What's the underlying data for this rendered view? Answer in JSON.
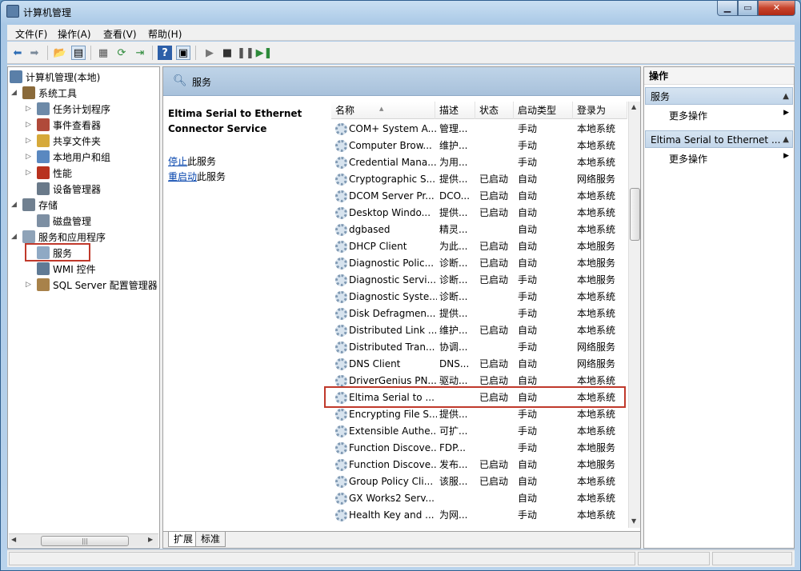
{
  "window": {
    "title": "计算机管理"
  },
  "menu": [
    "文件(F)",
    "操作(A)",
    "查看(V)",
    "帮助(H)"
  ],
  "tree": [
    {
      "label": "计算机管理(本地)",
      "icon": "computer-icon",
      "level": 0,
      "toggle": ""
    },
    {
      "label": "系统工具",
      "icon": "tools-icon",
      "level": 1,
      "toggle": "▲"
    },
    {
      "label": "任务计划程序",
      "icon": "clock-icon",
      "level": 2,
      "toggle": "▷"
    },
    {
      "label": "事件查看器",
      "icon": "event-viewer-icon",
      "level": 2,
      "toggle": "▷"
    },
    {
      "label": "共享文件夹",
      "icon": "shared-folder-icon",
      "level": 2,
      "toggle": "▷"
    },
    {
      "label": "本地用户和组",
      "icon": "users-icon",
      "level": 2,
      "toggle": "▷"
    },
    {
      "label": "性能",
      "icon": "performance-icon",
      "level": 2,
      "toggle": "▷"
    },
    {
      "label": "设备管理器",
      "icon": "device-manager-icon",
      "level": 2,
      "toggle": ""
    },
    {
      "label": "存储",
      "icon": "storage-icon",
      "level": 1,
      "toggle": "▲"
    },
    {
      "label": "磁盘管理",
      "icon": "disk-icon",
      "level": 2,
      "toggle": ""
    },
    {
      "label": "服务和应用程序",
      "icon": "services-apps-icon",
      "level": 1,
      "toggle": "▲"
    },
    {
      "label": "服务",
      "icon": "gear-icon",
      "level": 2,
      "toggle": ""
    },
    {
      "label": "WMI 控件",
      "icon": "wmi-icon",
      "level": 2,
      "toggle": ""
    },
    {
      "label": "SQL Server 配置管理器",
      "icon": "sql-icon",
      "level": 2,
      "toggle": "▷"
    }
  ],
  "middle": {
    "header_title": "服务",
    "selected_service": "Eltima Serial to Ethernet Connector Service",
    "stop_link": "停止",
    "stop_suffix": "此服务",
    "restart_link": "重启动",
    "restart_suffix": "此服务",
    "columns": [
      "名称",
      "描述",
      "状态",
      "启动类型",
      "登录为"
    ],
    "tabs": [
      "扩展",
      "标准"
    ]
  },
  "services": [
    [
      "COM+ System A...",
      "管理...",
      "",
      "手动",
      "本地系统"
    ],
    [
      "Computer Brow...",
      "维护...",
      "",
      "手动",
      "本地系统"
    ],
    [
      "Credential Mana...",
      "为用...",
      "",
      "手动",
      "本地系统"
    ],
    [
      "Cryptographic S...",
      "提供...",
      "已启动",
      "自动",
      "网络服务"
    ],
    [
      "DCOM Server Pr...",
      "DCO...",
      "已启动",
      "自动",
      "本地系统"
    ],
    [
      "Desktop Windo...",
      "提供...",
      "已启动",
      "自动",
      "本地系统"
    ],
    [
      "dgbased",
      "精灵...",
      "",
      "自动",
      "本地系统"
    ],
    [
      "DHCP Client",
      "为此...",
      "已启动",
      "自动",
      "本地服务"
    ],
    [
      "Diagnostic Polic...",
      "诊断...",
      "已启动",
      "自动",
      "本地服务"
    ],
    [
      "Diagnostic Servi...",
      "诊断...",
      "已启动",
      "手动",
      "本地服务"
    ],
    [
      "Diagnostic Syste...",
      "诊断...",
      "",
      "手动",
      "本地系统"
    ],
    [
      "Disk Defragmen...",
      "提供...",
      "",
      "手动",
      "本地系统"
    ],
    [
      "Distributed Link ...",
      "维护...",
      "已启动",
      "自动",
      "本地系统"
    ],
    [
      "Distributed Tran...",
      "协调...",
      "",
      "手动",
      "网络服务"
    ],
    [
      "DNS Client",
      "DNS...",
      "已启动",
      "自动",
      "网络服务"
    ],
    [
      "DriverGenius PN...",
      "驱动...",
      "已启动",
      "自动",
      "本地系统"
    ],
    [
      "Eltima Serial to ...",
      "",
      "已启动",
      "自动",
      "本地系统"
    ],
    [
      "Encrypting File S...",
      "提供...",
      "",
      "手动",
      "本地系统"
    ],
    [
      "Extensible Authe...",
      "可扩...",
      "",
      "手动",
      "本地系统"
    ],
    [
      "Function Discove...",
      "FDP...",
      "",
      "手动",
      "本地服务"
    ],
    [
      "Function Discove...",
      "发布...",
      "已启动",
      "自动",
      "本地服务"
    ],
    [
      "Group Policy Cli...",
      "该服...",
      "已启动",
      "自动",
      "本地系统"
    ],
    [
      "GX Works2 Serv...",
      "",
      "",
      "自动",
      "本地系统"
    ],
    [
      "Health Key and ...",
      "为网...",
      "",
      "手动",
      "本地系统"
    ]
  ],
  "actions": {
    "title": "操作",
    "section1": "服务",
    "section1_more": "更多操作",
    "section2": "Eltima Serial to Ethernet ...",
    "section2_more": "更多操作"
  },
  "colors": {
    "highlight_box": "#c0392b",
    "link": "#0645ad"
  }
}
